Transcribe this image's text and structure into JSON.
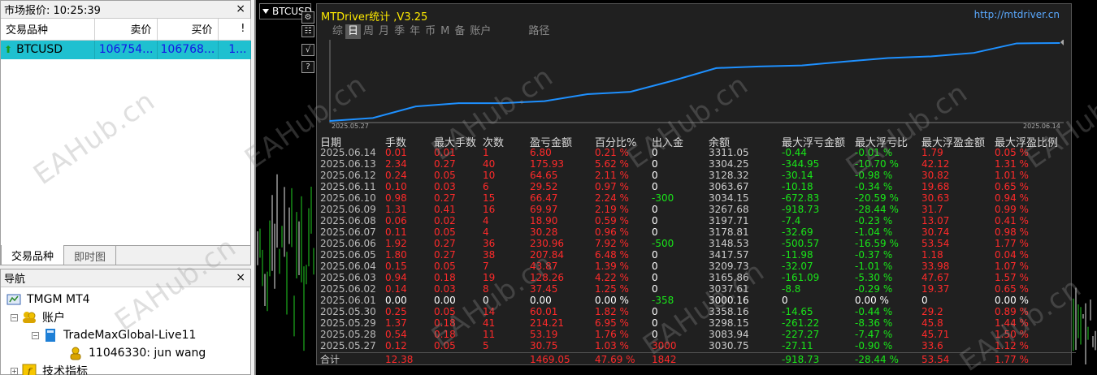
{
  "market_watch": {
    "title": "市场报价: 10:25:39",
    "close": "×",
    "columns": [
      "交易品种",
      "卖价",
      "买价",
      "!"
    ],
    "rows": [
      {
        "symbol": "BTCUSD",
        "bid": "106754...",
        "ask": "106768...",
        "spread": "1..."
      }
    ],
    "tabs": [
      "交易品种",
      "即时图"
    ]
  },
  "navigator": {
    "title": "导航",
    "close": "×",
    "items": [
      {
        "label": "TMGM MT4",
        "icon": "terminal-icon"
      },
      {
        "label": "账户",
        "icon": "accounts-icon"
      },
      {
        "label": "TradeMaxGlobal-Live11",
        "icon": "server-icon"
      },
      {
        "label": "11046330: jun wang",
        "icon": "user-icon"
      },
      {
        "label": "技术指标",
        "icon": "indicator-icon"
      }
    ]
  },
  "chart": {
    "symbol_tab": "BTCUSD",
    "side_buttons": [
      "⚙",
      "☷",
      "√",
      "?"
    ]
  },
  "panel": {
    "title": "MTDriver统计 ,V3.25",
    "url": "http://mtdriver.cn",
    "tabs": [
      "综",
      "日",
      "周",
      "月",
      "季",
      "年",
      "币",
      "M",
      "备",
      "账户",
      "",
      "路径"
    ],
    "active_tab": 1,
    "curve_start_date": "2025.05.27",
    "curve_end_date": "2025.06.14",
    "columns": [
      "日期",
      "手数",
      "最大手数",
      "次数",
      "盈亏金额",
      "百分比%",
      "出入金",
      "余额",
      "最大浮亏金额",
      "最大浮亏比",
      "最大浮盈金额",
      "最大浮盈比例"
    ],
    "rows": [
      [
        "2025.06.14",
        "0.01",
        "0.01",
        "1",
        "6.80",
        "0.21 %",
        "0",
        "3311.05",
        "-0.44",
        "-0.01 %",
        "1.79",
        "0.05 %"
      ],
      [
        "2025.06.13",
        "2.34",
        "0.27",
        "40",
        "175.93",
        "5.62 %",
        "0",
        "3304.25",
        "-344.95",
        "-10.70 %",
        "42.12",
        "1.31 %"
      ],
      [
        "2025.06.12",
        "0.24",
        "0.05",
        "10",
        "64.65",
        "2.11 %",
        "0",
        "3128.32",
        "-30.14",
        "-0.98 %",
        "30.82",
        "1.01 %"
      ],
      [
        "2025.06.11",
        "0.10",
        "0.03",
        "6",
        "29.52",
        "0.97 %",
        "0",
        "3063.67",
        "-10.18",
        "-0.34 %",
        "19.68",
        "0.65 %"
      ],
      [
        "2025.06.10",
        "0.98",
        "0.27",
        "15",
        "66.47",
        "2.24 %",
        "-300",
        "3034.15",
        "-672.83",
        "-20.59 %",
        "30.63",
        "0.94 %"
      ],
      [
        "2025.06.09",
        "1.31",
        "0.41",
        "16",
        "69.97",
        "2.19 %",
        "0",
        "3267.68",
        "-918.73",
        "-28.44 %",
        "31.7",
        "0.99 %"
      ],
      [
        "2025.06.08",
        "0.06",
        "0.02",
        "4",
        "18.90",
        "0.59 %",
        "0",
        "3197.71",
        "-7.4",
        "-0.23 %",
        "13.07",
        "0.41 %"
      ],
      [
        "2025.06.07",
        "0.11",
        "0.05",
        "4",
        "30.28",
        "0.96 %",
        "0",
        "3178.81",
        "-32.69",
        "-1.04 %",
        "30.74",
        "0.98 %"
      ],
      [
        "2025.06.06",
        "1.92",
        "0.27",
        "36",
        "230.96",
        "7.92 %",
        "-500",
        "3148.53",
        "-500.57",
        "-16.59 %",
        "53.54",
        "1.77 %"
      ],
      [
        "2025.06.05",
        "1.80",
        "0.27",
        "38",
        "207.84",
        "6.48 %",
        "0",
        "3417.57",
        "-11.98",
        "-0.37 %",
        "1.18",
        "0.04 %"
      ],
      [
        "2025.06.04",
        "0.15",
        "0.05",
        "7",
        "43.87",
        "1.39 %",
        "0",
        "3209.73",
        "-32.07",
        "-1.01 %",
        "33.98",
        "1.07 %"
      ],
      [
        "2025.06.03",
        "0.94",
        "0.18",
        "19",
        "128.26",
        "4.22 %",
        "0",
        "3165.86",
        "-161.09",
        "-5.30 %",
        "47.67",
        "1.57 %"
      ],
      [
        "2025.06.02",
        "0.14",
        "0.03",
        "8",
        "37.45",
        "1.25 %",
        "0",
        "3037.61",
        "-8.8",
        "-0.29 %",
        "19.37",
        "0.65 %"
      ],
      [
        "2025.06.01",
        "0.00",
        "0.00",
        "0",
        "0.00",
        "0.00 %",
        "-358",
        "3000.16",
        "0",
        "0.00 %",
        "0",
        "0.00 %"
      ],
      [
        "2025.05.30",
        "0.25",
        "0.05",
        "14",
        "60.01",
        "1.82 %",
        "0",
        "3358.16",
        "-14.65",
        "-0.44 %",
        "29.2",
        "0.89 %"
      ],
      [
        "2025.05.29",
        "1.37",
        "0.18",
        "41",
        "214.21",
        "6.95 %",
        "0",
        "3298.15",
        "-261.22",
        "-8.36 %",
        "45.8",
        "1.44 %"
      ],
      [
        "2025.05.28",
        "0.54",
        "0.18",
        "11",
        "53.19",
        "1.76 %",
        "0",
        "3083.94",
        "-227.27",
        "-7.47 %",
        "45.71",
        "1.50 %"
      ],
      [
        "2025.05.27",
        "0.12",
        "0.05",
        "5",
        "30.75",
        "1.03 %",
        "3000",
        "3030.75",
        "-27.11",
        "-0.90 %",
        "33.6",
        "1.12 %"
      ]
    ],
    "total": [
      "合计",
      "12.38",
      "",
      "",
      "1469.05",
      "47.69 %",
      "1842",
      "",
      "-918.73",
      "-28.44 %",
      "53.54",
      "1.77 %"
    ]
  },
  "chart_data": {
    "type": "line",
    "x": [
      "2025.05.27",
      "2025.05.28",
      "2025.05.29",
      "2025.05.30",
      "2025.06.01",
      "2025.06.02",
      "2025.06.03",
      "2025.06.04",
      "2025.06.05",
      "2025.06.06",
      "2025.06.07",
      "2025.06.08",
      "2025.06.09",
      "2025.06.10",
      "2025.06.11",
      "2025.06.12",
      "2025.06.13",
      "2025.06.14"
    ],
    "values": [
      30.75,
      83.94,
      298.15,
      358.16,
      358.16,
      395.61,
      523.87,
      567.74,
      775.58,
      1006.54,
      1036.82,
      1055.72,
      1125.69,
      1192.16,
      1221.68,
      1286.33,
      1462.26,
      1469.05
    ],
    "color": "#1e90ff"
  },
  "watermark": "EAHub.cn"
}
